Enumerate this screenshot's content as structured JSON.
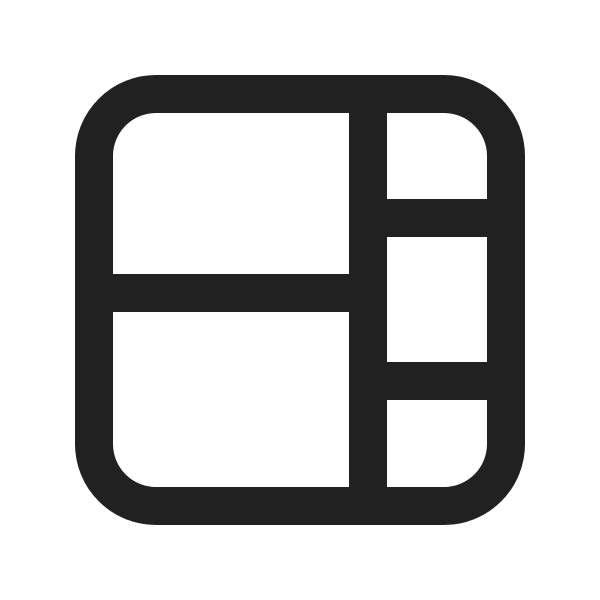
{
  "icon": {
    "name": "panel-grid-layout-icon",
    "stroke_color": "#212121",
    "background": "#ffffff"
  }
}
